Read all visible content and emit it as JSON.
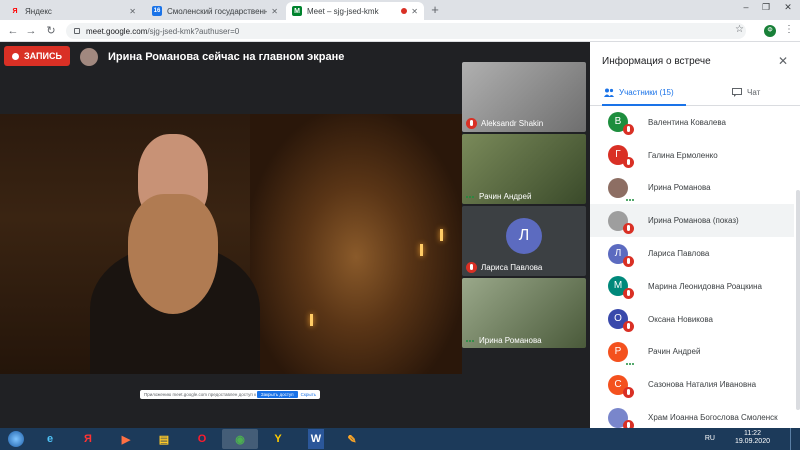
{
  "browser": {
    "tabs": [
      {
        "label": "Яндекс",
        "favicon": "Я",
        "favicon_color": "#ff0000",
        "active": false
      },
      {
        "label": "Смоленский государственный",
        "favicon": "16",
        "favicon_color": "#1a73e8",
        "active": false
      },
      {
        "label": "Meet – sjg-jsed-kmk",
        "favicon": "M",
        "favicon_color": "#00832d",
        "active": true,
        "recording": true
      }
    ],
    "new_tab_icon": "plus-icon",
    "url_domain": "meet.google.com",
    "url_path": "/sjg-jsed-kmk?authuser=0",
    "profile_initial": "Ф"
  },
  "meet": {
    "record_label": "ЗАПИСЬ",
    "presenter_banner": "Ирина Романова сейчас на главном экране",
    "share_notice": "Приложению meet.google.com предоставлен доступ к вашему экрану",
    "share_stop": "Закрыть доступ",
    "share_hide": "Скрыть",
    "tiles": [
      {
        "name": "Aleksandr Shakin",
        "muted": true,
        "bg": "#8a8a8a"
      },
      {
        "name": "Рачин Андрей",
        "muted": false,
        "bg": "#5b6b4a"
      },
      {
        "name": "Лариса Павлова",
        "muted": true,
        "letter": "Л",
        "bg": "#3c4043"
      },
      {
        "name": "Ирина Романова",
        "muted": false,
        "bg": "#7a8a6a"
      }
    ]
  },
  "panel": {
    "title": "Информация о встрече",
    "tab_people": "Участники (15)",
    "tab_chat": "Чат",
    "participants": [
      {
        "name": "Валентина Ковалева",
        "letter": "В",
        "color": "#1e8e3e",
        "muted": true
      },
      {
        "name": "Галина Ермоленко",
        "letter": "Г",
        "color": "#d93025",
        "muted": true
      },
      {
        "name": "Ирина Романова",
        "letter": "",
        "color": "#8d6e63",
        "muted": false
      },
      {
        "name": "Ирина Романова (показ)",
        "letter": "",
        "color": "#9e9e9e",
        "muted": true,
        "highlight": true
      },
      {
        "name": "Лариса Павлова",
        "letter": "Л",
        "color": "#5c6bc0",
        "muted": true
      },
      {
        "name": "Марина Леонидовна Роацкина",
        "letter": "М",
        "color": "#00897b",
        "muted": true
      },
      {
        "name": "Оксана Новикова",
        "letter": "О",
        "color": "#3949ab",
        "muted": true
      },
      {
        "name": "Рачин Андрей",
        "letter": "Р",
        "color": "#f4511e",
        "muted": false
      },
      {
        "name": "Сазонова Наталия Ивановна",
        "letter": "С",
        "color": "#f4511e",
        "muted": true
      },
      {
        "name": "Храм Иоанна Богослова Смоленск",
        "letter": "",
        "color": "#7986cb",
        "muted": true
      }
    ]
  },
  "taskbar": {
    "apps": [
      {
        "icon": "ie-icon",
        "glyph": "e",
        "color": "#4fc3f7"
      },
      {
        "icon": "yandex-icon",
        "glyph": "Я",
        "color": "#ff3333"
      },
      {
        "icon": "media-icon",
        "glyph": "▶",
        "color": "#ff7043"
      },
      {
        "icon": "explorer-icon",
        "glyph": "▤",
        "color": "#ffca28"
      },
      {
        "icon": "opera-icon",
        "glyph": "O",
        "color": "#ff1b2d"
      },
      {
        "icon": "chrome-icon",
        "glyph": "◉",
        "color": "#4caf50",
        "active": true
      },
      {
        "icon": "yandex-browser-icon",
        "glyph": "Y",
        "color": "#ffcc00"
      },
      {
        "icon": "word-icon",
        "glyph": "W",
        "color": "#2b579a"
      },
      {
        "icon": "paint-icon",
        "glyph": "✎",
        "color": "#ffa726"
      }
    ],
    "lang": "RU",
    "time": "11:22",
    "date": "19.09.2020"
  }
}
